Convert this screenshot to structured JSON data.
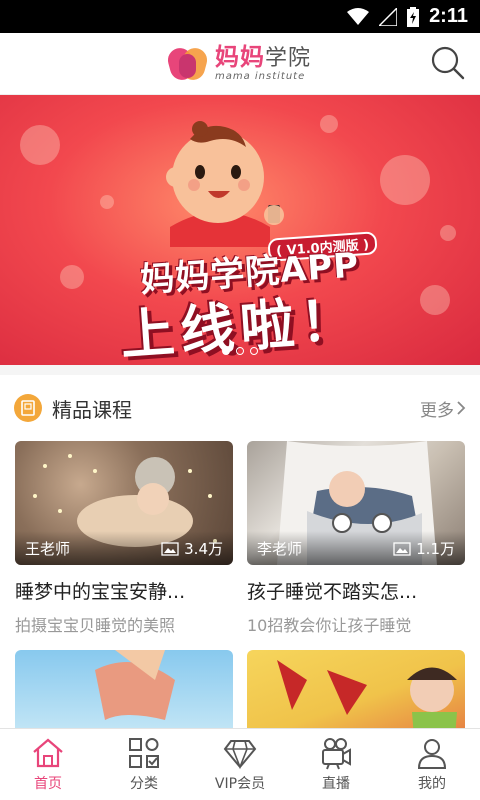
{
  "status_bar": {
    "time": "2:11"
  },
  "header": {
    "logo_cn_brand": "妈妈",
    "logo_cn_rest": "学院",
    "logo_en": "mama institute"
  },
  "banner": {
    "version_tag": "( V1.0内测版 )",
    "title": "妈妈学院APP",
    "subtitle": "上线啦！",
    "slides": 3,
    "active_slide": 0
  },
  "section": {
    "title": "精品课程",
    "more_label": "更多"
  },
  "courses": [
    {
      "teacher": "王老师",
      "views": "3.4万",
      "title": "睡梦中的宝宝安静...",
      "desc": "拍摄宝宝贝睡觉的美照"
    },
    {
      "teacher": "李老师",
      "views": "1.1万",
      "title": "孩子睡觉不踏实怎...",
      "desc": "10招教会你让孩子睡觉"
    },
    {
      "teacher": "",
      "views": "",
      "title": "",
      "desc": ""
    },
    {
      "teacher": "",
      "views": "",
      "title": "",
      "desc": ""
    }
  ],
  "tabs": [
    {
      "label": "首页",
      "icon": "home-icon",
      "active": true
    },
    {
      "label": "分类",
      "icon": "category-icon",
      "active": false
    },
    {
      "label": "VIP会员",
      "icon": "diamond-icon",
      "active": false
    },
    {
      "label": "直播",
      "icon": "video-camera-icon",
      "active": false
    },
    {
      "label": "我的",
      "icon": "user-icon",
      "active": false
    }
  ],
  "colors": {
    "accent": "#e8457a",
    "banner": "#f2484e",
    "section_icon": "#f3a73a"
  }
}
